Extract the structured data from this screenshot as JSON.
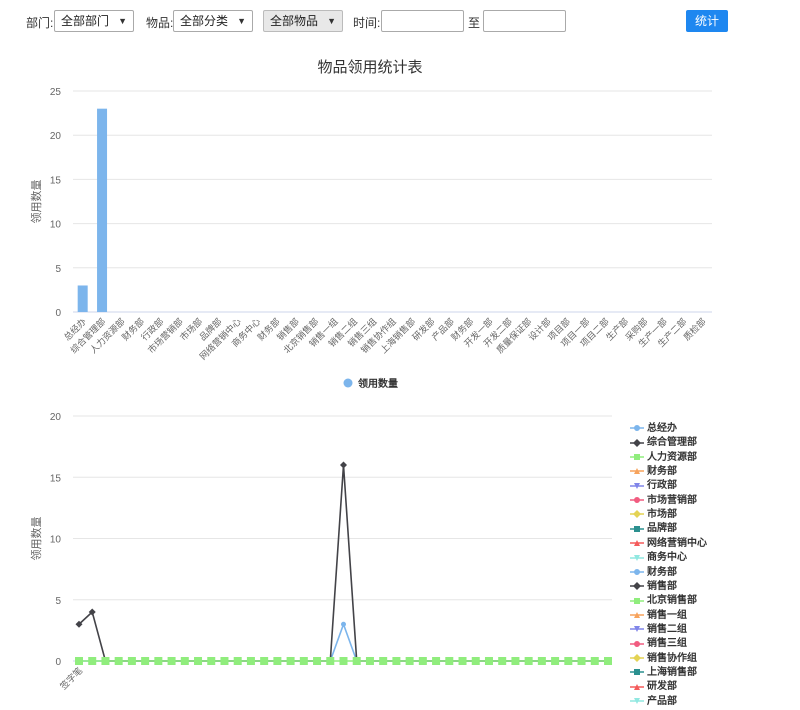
{
  "filters": {
    "dept_label": "部门:",
    "dept_value": "全部部门",
    "item_label": "物品:",
    "category_value": "全部分类",
    "goods_value": "全部物品",
    "time_label": "时间:",
    "time_to": "至",
    "time_start": "",
    "time_end": "",
    "submit_label": "统计"
  },
  "colors": {
    "bar": "#7cb5ec",
    "accent": "#1e87f0"
  },
  "chart_data": [
    {
      "type": "bar",
      "title": "物品领用统计表",
      "ylabel": "领用数量",
      "ylim": [
        0,
        25
      ],
      "yticks": [
        0,
        5,
        10,
        15,
        20,
        25
      ],
      "grid": true,
      "legend": "bottom-center",
      "categories": [
        "总经办",
        "综合管理部",
        "人力资源部",
        "财务部",
        "行政部",
        "市场营销部",
        "市场部",
        "品牌部",
        "网络营销中心",
        "商务中心",
        "财务部",
        "销售部",
        "北京销售部",
        "销售一组",
        "销售二组",
        "销售三组",
        "销售协作组",
        "上海销售部",
        "研发部",
        "产品部",
        "财务部",
        "开发一部",
        "开发二部",
        "质量保证部",
        "设计部",
        "项目部",
        "项目一部",
        "项目二部",
        "生产部",
        "采购部",
        "生产一部",
        "生产二部",
        "质检部"
      ],
      "series": [
        {
          "name": "领用数量",
          "values": [
            3,
            23,
            0,
            0,
            0,
            0,
            0,
            0,
            0,
            0,
            0,
            0,
            0,
            0,
            0,
            0,
            0,
            0,
            0,
            0,
            0,
            0,
            0,
            0,
            0,
            0,
            0,
            0,
            0,
            0,
            0,
            0,
            0
          ]
        }
      ]
    },
    {
      "type": "line",
      "ylabel": "领用数量",
      "ylim": [
        0,
        20
      ],
      "yticks": [
        0,
        5,
        10,
        15,
        20
      ],
      "grid": true,
      "legend": "right",
      "x_first_label": "签字笔",
      "x_count": 41,
      "series": [
        {
          "name": "总经办",
          "color": "#7cb5ec",
          "marker": "circle",
          "values": [
            0,
            0,
            0,
            0,
            0,
            0,
            0,
            0,
            0,
            0,
            0,
            0,
            0,
            0,
            0,
            0,
            0,
            0,
            0,
            0,
            3,
            0,
            0,
            0,
            0,
            0,
            0,
            0,
            0,
            0,
            0,
            0,
            0,
            0,
            0,
            0,
            0,
            0,
            0,
            0,
            0
          ]
        },
        {
          "name": "综合管理部",
          "color": "#434348",
          "marker": "diamond",
          "values": [
            3,
            4,
            0,
            0,
            0,
            0,
            0,
            0,
            0,
            0,
            0,
            0,
            0,
            0,
            0,
            0,
            0,
            0,
            0,
            0,
            16,
            0,
            0,
            0,
            0,
            0,
            0,
            0,
            0,
            0,
            0,
            0,
            0,
            0,
            0,
            0,
            0,
            0,
            0,
            0,
            0
          ]
        },
        {
          "name": "人力资源部",
          "color": "#90ed7d",
          "marker": "square",
          "values": [
            0,
            0,
            0,
            0,
            0,
            0,
            0,
            0,
            0,
            0,
            0,
            0,
            0,
            0,
            0,
            0,
            0,
            0,
            0,
            0,
            0,
            0,
            0,
            0,
            0,
            0,
            0,
            0,
            0,
            0,
            0,
            0,
            0,
            0,
            0,
            0,
            0,
            0,
            0,
            0,
            0
          ]
        },
        {
          "name": "财务部",
          "color": "#f7a35c",
          "marker": "triangle"
        },
        {
          "name": "行政部",
          "color": "#8085e9",
          "marker": "triangle-down"
        },
        {
          "name": "市场营销部",
          "color": "#f15c80",
          "marker": "circle"
        },
        {
          "name": "市场部",
          "color": "#e4d354",
          "marker": "diamond"
        },
        {
          "name": "品牌部",
          "color": "#2b908f",
          "marker": "square"
        },
        {
          "name": "网络营销中心",
          "color": "#f45b5b",
          "marker": "triangle"
        },
        {
          "name": "商务中心",
          "color": "#91e8e1",
          "marker": "triangle-down"
        },
        {
          "name": "财务部",
          "color": "#7cb5ec",
          "marker": "circle"
        },
        {
          "name": "销售部",
          "color": "#434348",
          "marker": "diamond"
        },
        {
          "name": "北京销售部",
          "color": "#90ed7d",
          "marker": "square"
        },
        {
          "name": "销售一组",
          "color": "#f7a35c",
          "marker": "triangle"
        },
        {
          "name": "销售二组",
          "color": "#8085e9",
          "marker": "triangle-down"
        },
        {
          "name": "销售三组",
          "color": "#f15c80",
          "marker": "circle"
        },
        {
          "name": "销售协作组",
          "color": "#e4d354",
          "marker": "diamond"
        },
        {
          "name": "上海销售部",
          "color": "#2b908f",
          "marker": "square"
        },
        {
          "name": "研发部",
          "color": "#f45b5b",
          "marker": "triangle"
        },
        {
          "name": "产品部",
          "color": "#91e8e1",
          "marker": "triangle-down"
        }
      ]
    }
  ]
}
